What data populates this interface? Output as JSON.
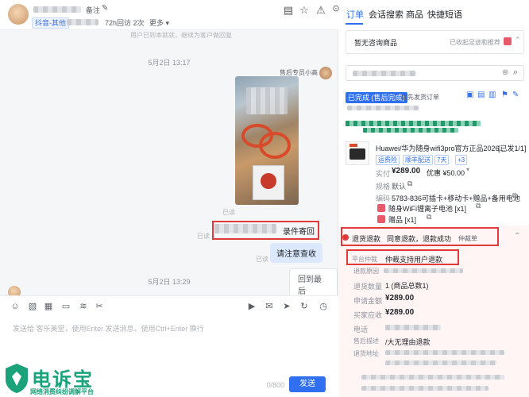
{
  "chat": {
    "header": {
      "remark_label": "备注",
      "source_tag": "抖音-其他",
      "visit_info": "72h回访 2次",
      "more_label": "更多"
    },
    "system_hint": "用户已到本就就，继续为客户做回复",
    "messages": [
      {
        "time": "5月2日 13:17"
      },
      {
        "agent_name": "售后专员小高"
      },
      {
        "read": "已读"
      },
      {
        "text": "录件寄回",
        "read": "已读"
      },
      {
        "text": "请注意查收",
        "read": "已读"
      },
      {
        "button": "回到最后"
      },
      {
        "time": "5月2日 13:29"
      }
    ],
    "input": {
      "placeholder": "发送给 客乐美堂，使用Enter 发送消息，使用Ctrl+Enter 换行",
      "counter": "0/800",
      "send_label": "发送"
    }
  },
  "watermark": {
    "title": "电诉宝",
    "subtitle": "网络消费纠纷调解平台"
  },
  "panel": {
    "tabs": [
      "订单",
      "会话搜索",
      "商品",
      "快捷短语"
    ],
    "active_tab": 0,
    "consult": {
      "label": "暂无咨询商品",
      "right_label": "已收起足迹和推荐"
    },
    "order": {
      "status": "已完成 (售后完成)",
      "priority_tag": "优先发货订单",
      "product_title": "Huawei/华为随身wifi3pro官方正品2026...",
      "shipped": "[已发1/1]",
      "chips": [
        "运费险",
        "顺丰配送",
        "7天",
        "+3"
      ],
      "paid_label": "实付",
      "paid_value": "¥289.00",
      "discount": "优惠 ¥50.00",
      "spec_label": "规格",
      "spec_value": "默认",
      "code_label": "编码",
      "code_value": "5783-836可插卡+移动卡+赠品+备用电池",
      "gifts": [
        "随身WiFi锂离子电池 [x1]",
        "赠品 [x1]"
      ]
    },
    "refund": {
      "title": "退货退款",
      "status": "同意退款，退款成功",
      "arbitration": "仲裁单",
      "platform_label": "平台仲裁",
      "platform_value": "仲裁支持用户退款",
      "reason_label": "退款原因",
      "qty_label": "退货数量",
      "qty_value": "1 (商品总数1)",
      "apply_label": "申请金额",
      "apply_value": "¥289.00",
      "buyer_label": "买家应收",
      "buyer_value": "¥289.00",
      "phone_label": "电话",
      "desc_label": "售后描述",
      "desc_value": "/大无理由退款",
      "addr_label": "退货地址"
    }
  }
}
